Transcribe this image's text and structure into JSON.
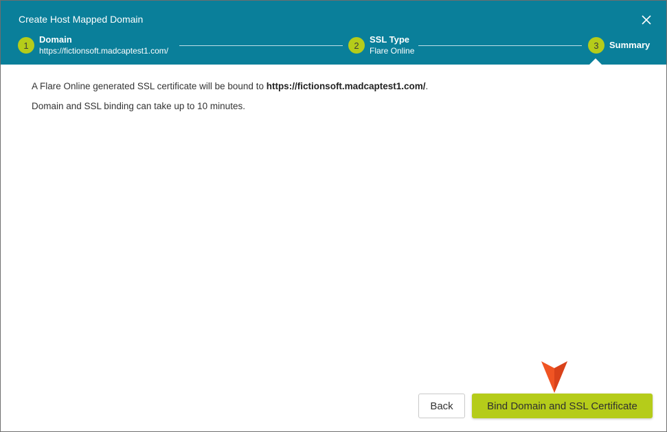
{
  "dialog": {
    "title": "Create Host Mapped Domain",
    "close_icon": "close-icon"
  },
  "steps": [
    {
      "number": "1",
      "name": "Domain",
      "sub": "https://fictionsoft.madcaptest1.com/"
    },
    {
      "number": "2",
      "name": "SSL Type",
      "sub": "Flare Online"
    },
    {
      "number": "3",
      "name": "Summary"
    }
  ],
  "summary": {
    "line1_prefix": "A Flare Online generated SSL certificate will be bound to ",
    "line1_url": "https://fictionsoft.madcaptest1.com/",
    "line1_suffix": ".",
    "line2": "Domain and SSL binding can take up to 10 minutes."
  },
  "footer": {
    "back_label": "Back",
    "bind_label": "Bind Domain and SSL Certificate"
  },
  "colors": {
    "header": "#0a7f9a",
    "accent": "#b5cc1a",
    "pointer": "#f05423"
  }
}
